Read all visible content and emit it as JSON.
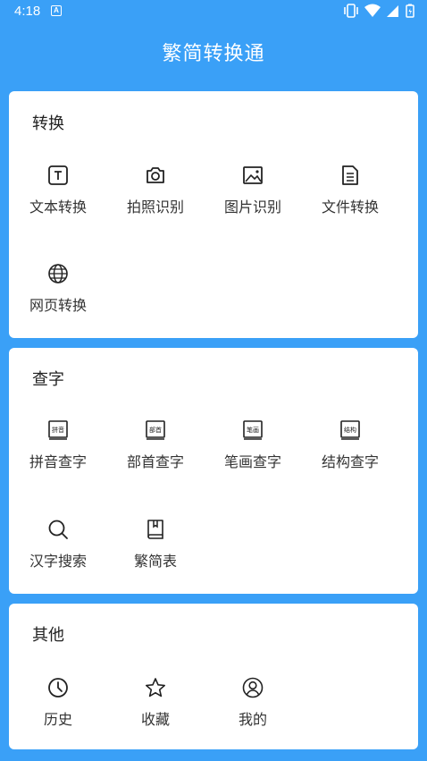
{
  "status": {
    "time": "4:18",
    "notif_glyph": "A"
  },
  "app": {
    "title": "繁简转换通"
  },
  "sections": [
    {
      "title": "转换",
      "items": [
        {
          "label": "文本转换",
          "icon": "text-icon"
        },
        {
          "label": "拍照识别",
          "icon": "camera-icon"
        },
        {
          "label": "图片识别",
          "icon": "image-icon"
        },
        {
          "label": "文件转换",
          "icon": "document-icon"
        },
        {
          "label": "网页转换",
          "icon": "globe-icon"
        }
      ]
    },
    {
      "title": "查字",
      "items": [
        {
          "label": "拼音查字",
          "icon": "pinyin-book-icon",
          "badge": "拼音"
        },
        {
          "label": "部首查字",
          "icon": "radical-book-icon",
          "badge": "部首"
        },
        {
          "label": "笔画查字",
          "icon": "stroke-book-icon",
          "badge": "笔画"
        },
        {
          "label": "结构查字",
          "icon": "structure-book-icon",
          "badge": "结构"
        },
        {
          "label": "汉字搜索",
          "icon": "search-icon"
        },
        {
          "label": "繁简表",
          "icon": "table-book-icon"
        }
      ]
    },
    {
      "title": "其他",
      "items": [
        {
          "label": "历史",
          "icon": "clock-icon"
        },
        {
          "label": "收藏",
          "icon": "star-icon"
        },
        {
          "label": "我的",
          "icon": "user-icon"
        }
      ]
    }
  ]
}
